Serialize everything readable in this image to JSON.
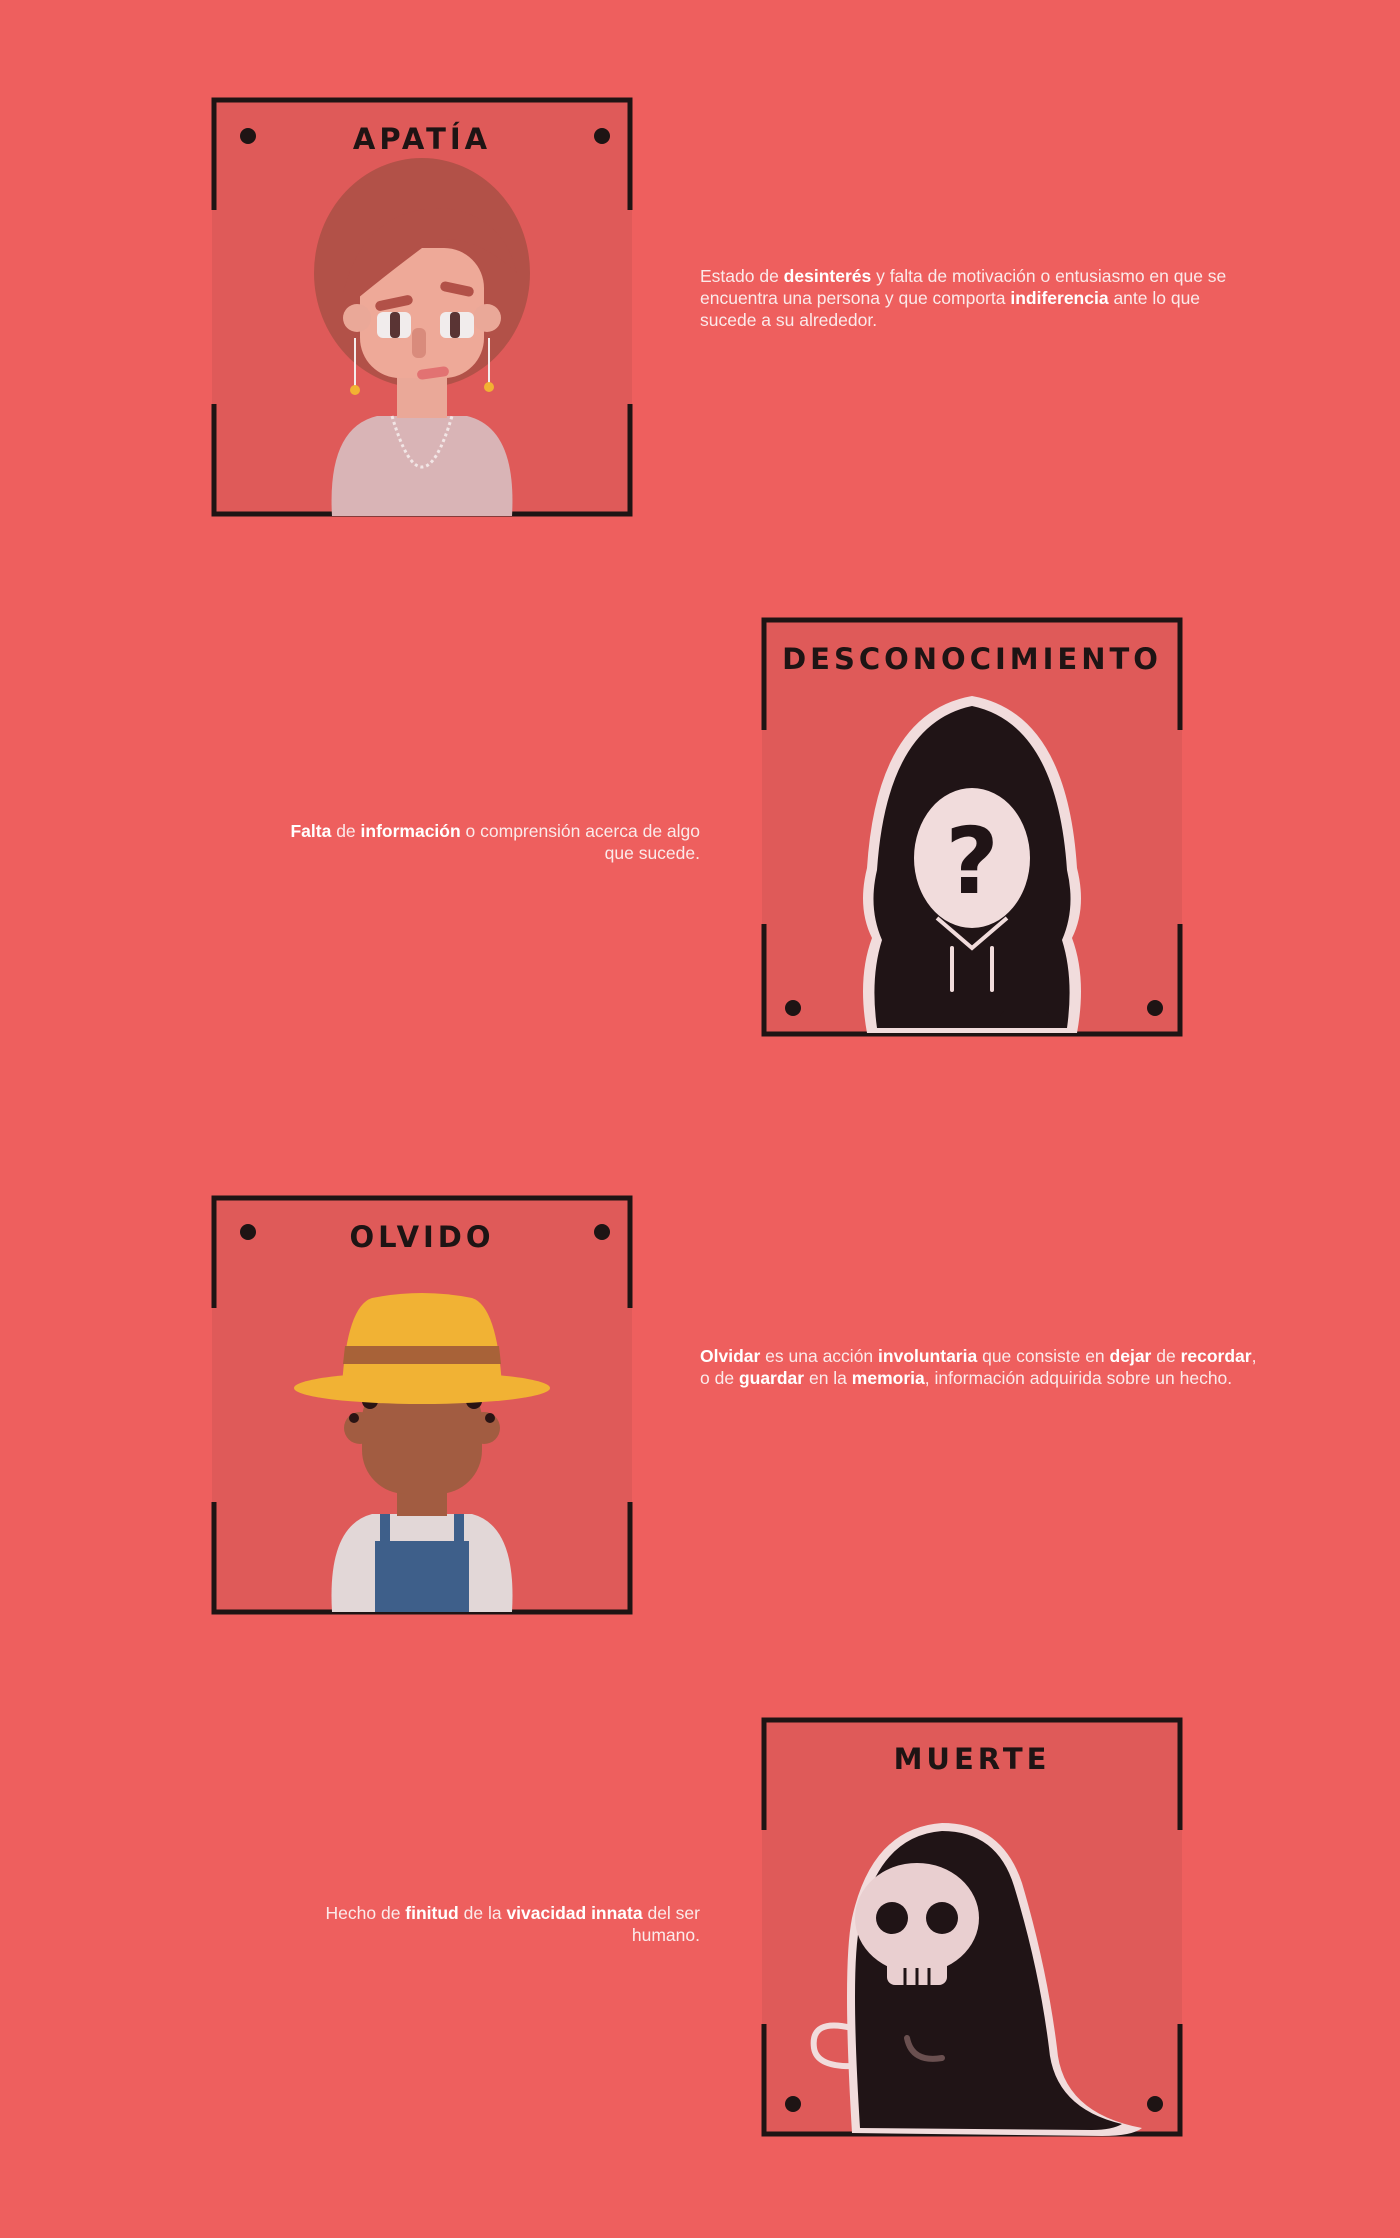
{
  "cards": [
    {
      "title": "APATÍA",
      "description": [
        [
          "Estado de ",
          false
        ],
        [
          "desinterés",
          true
        ],
        [
          " y falta de motivación o entusiasmo en que se encuentra una persona y que comporta ",
          false
        ],
        [
          "indiferencia",
          true
        ],
        [
          " ante lo que sucede a su alrededor.",
          false
        ]
      ]
    },
    {
      "title": "DESCONOCIMIENTO",
      "description": [
        [
          "Falta",
          true
        ],
        [
          " de ",
          false
        ],
        [
          "información",
          true
        ],
        [
          " o comprensión acerca de algo que sucede.",
          false
        ]
      ]
    },
    {
      "title": "OLVIDO",
      "description": [
        [
          "Olvidar",
          true
        ],
        [
          " es una acción ",
          false
        ],
        [
          "involuntaria",
          true
        ],
        [
          " que consiste en ",
          false
        ],
        [
          "dejar",
          true
        ],
        [
          " de ",
          false
        ],
        [
          "recordar",
          true
        ],
        [
          ", o de ",
          false
        ],
        [
          "guardar",
          true
        ],
        [
          " en la ",
          false
        ],
        [
          "memoria",
          true
        ],
        [
          ", información adquirida sobre un hecho.",
          false
        ]
      ]
    },
    {
      "title": "MUERTE",
      "description": [
        [
          "Hecho de ",
          false
        ],
        [
          "finitud",
          true
        ],
        [
          " de la ",
          false
        ],
        [
          "vivacidad innata",
          true
        ],
        [
          " del ser humano.",
          false
        ]
      ]
    }
  ],
  "colors": {
    "background": "#ee5f5e",
    "card": "#df5a59",
    "frame": "#1e1414"
  }
}
